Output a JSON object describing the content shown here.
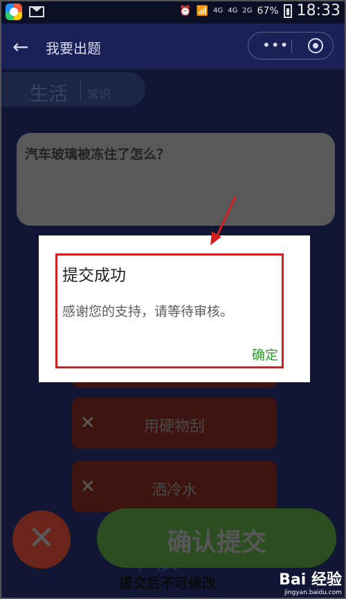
{
  "status_bar": {
    "network": "4G",
    "sim1": "4G",
    "sim2": "2G",
    "battery": "67%",
    "time": "18:33"
  },
  "nav": {
    "title": "我要出题",
    "more_icon": "•••"
  },
  "category": {
    "main": "生活",
    "sub": "常识"
  },
  "question": {
    "text": "汽车玻璃被冻住了怎么？"
  },
  "options": [
    {
      "label": "用硬物刮"
    },
    {
      "label": "洒冷水"
    }
  ],
  "confirm_button": {
    "label": "确认提交"
  },
  "cancel_button": {
    "icon": "close-icon"
  },
  "ghost_text": "审核",
  "note": "提交后不可修改",
  "dialog": {
    "title": "提交成功",
    "message": "感谢您的支持，请等待审核。",
    "ok": "确定"
  },
  "watermark": {
    "logo": "Bai  经验",
    "url": "jingyan.baidu.com"
  },
  "colors": {
    "highlight": "#d41e1e",
    "ok_green": "#2a9d2a",
    "nav_bg": "#1a2156"
  }
}
